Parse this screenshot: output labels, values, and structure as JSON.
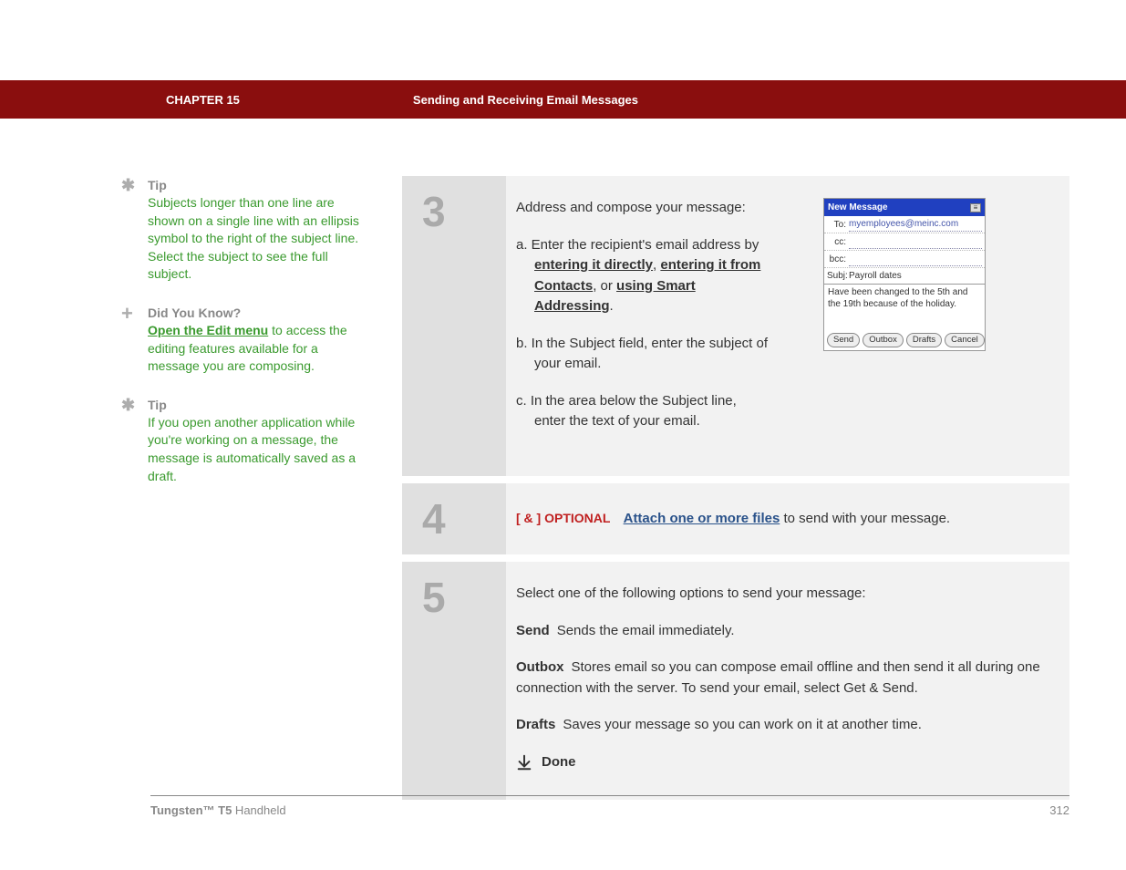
{
  "header": {
    "chapter": "CHAPTER 15",
    "title": "Sending and Receiving Email Messages"
  },
  "sidebar": {
    "items": [
      {
        "type": "tip",
        "label": "Tip",
        "body": "Subjects longer than one line are shown on a single line with an ellipsis symbol to the right of the subject line. Select the subject to see the full subject."
      },
      {
        "type": "dyk",
        "label": "Did You Know?",
        "link": "Open the Edit menu",
        "body_rest": " to access the editing features available for a message you are composing."
      },
      {
        "type": "tip",
        "label": "Tip",
        "body": "If you open another application while you're working on a message, the message is automatically saved as a draft."
      }
    ]
  },
  "steps": {
    "s3": {
      "num": "3",
      "intro": "Address and compose your message:",
      "a_prefix": "a.  Enter the recipient's email address by ",
      "a_link1": "entering it directly",
      "a_mid1": ", ",
      "a_link2": "entering it from Contacts",
      "a_mid2": ", or ",
      "a_link3": "using Smart Addressing",
      "a_end": ".",
      "b": "b.  In the Subject field, enter the subject of your email.",
      "c": "c.  In the area below the Subject line, enter the text of your email.",
      "mock": {
        "title": "New Message",
        "to_label": "To:",
        "to_value": "myemployees@meinc.com",
        "cc_label": "cc:",
        "bcc_label": "bcc:",
        "subj_label": "Subj:",
        "subj_value": "Payroll dates",
        "body": "Have been changed to the 5th and the 19th because of the holiday.",
        "btn_send": "Send",
        "btn_outbox": "Outbox",
        "btn_drafts": "Drafts",
        "btn_cancel": "Cancel"
      }
    },
    "s4": {
      "num": "4",
      "optional": "[ & ]  OPTIONAL",
      "link": "Attach one or more files",
      "rest": " to send with your message."
    },
    "s5": {
      "num": "5",
      "intro": "Select one of the following options to send your message:",
      "send_label": "Send",
      "send_body": "Sends the email immediately.",
      "outbox_label": "Outbox",
      "outbox_body": "Stores email so you can compose email offline and then send it all during one connection with the server. To send your email, select Get & Send.",
      "drafts_label": "Drafts",
      "drafts_body": "Saves your message so you can work on it at another time.",
      "done": "Done"
    }
  },
  "footer": {
    "product": "Tungsten™ T5",
    "suffix": " Handheld",
    "page": "312"
  }
}
